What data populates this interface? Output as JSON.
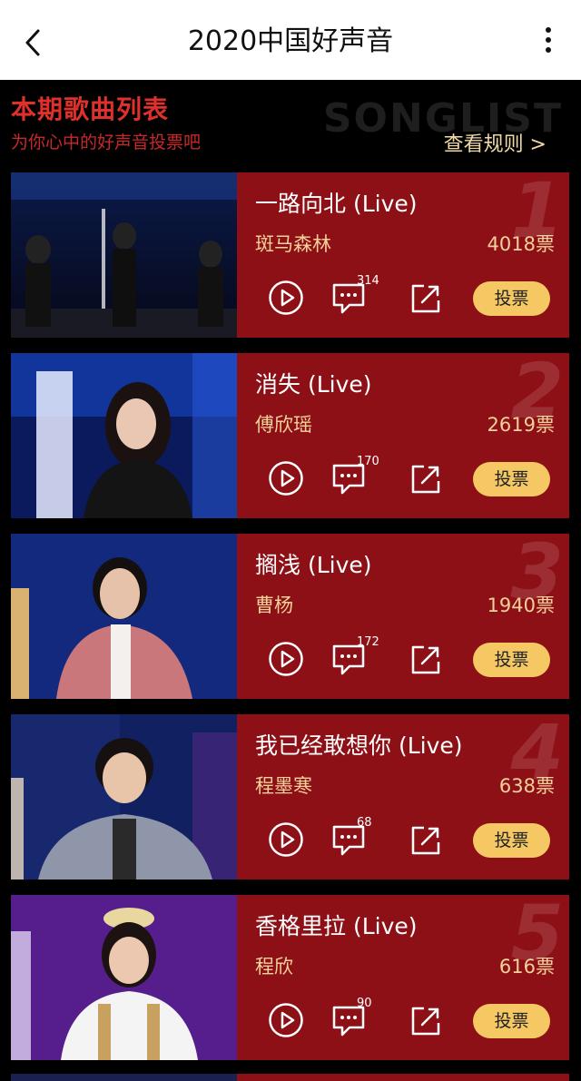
{
  "app": {
    "title": "2020中国好声音",
    "back_icon": "chevron-left-icon",
    "more_icon": "more-vertical-icon"
  },
  "header": {
    "title": "本期歌曲列表",
    "subtitle": "为你心中的好声音投票吧",
    "watermark": "SONGLIST",
    "rules_link": "查看规则 >"
  },
  "colors": {
    "panel": "#8e1017",
    "accent_text": "#f3d19a",
    "vote_button": "#f6c864",
    "header_red": "#e0302b"
  },
  "songs": [
    {
      "rank": "1",
      "title": "一路向北 (Live)",
      "singer": "斑马森林",
      "votes": "4018票",
      "comments": "314",
      "vote_label": "投票"
    },
    {
      "rank": "2",
      "title": "消失 (Live)",
      "singer": "傅欣瑶",
      "votes": "2619票",
      "comments": "170",
      "vote_label": "投票"
    },
    {
      "rank": "3",
      "title": "搁浅 (Live)",
      "singer": "曹杨",
      "votes": "1940票",
      "comments": "172",
      "vote_label": "投票"
    },
    {
      "rank": "4",
      "title": "我已经敢想你 (Live)",
      "singer": "程墨寒",
      "votes": "638票",
      "comments": "68",
      "vote_label": "投票"
    },
    {
      "rank": "5",
      "title": "香格里拉 (Live)",
      "singer": "程欣",
      "votes": "616票",
      "comments": "90",
      "vote_label": "投票"
    }
  ]
}
